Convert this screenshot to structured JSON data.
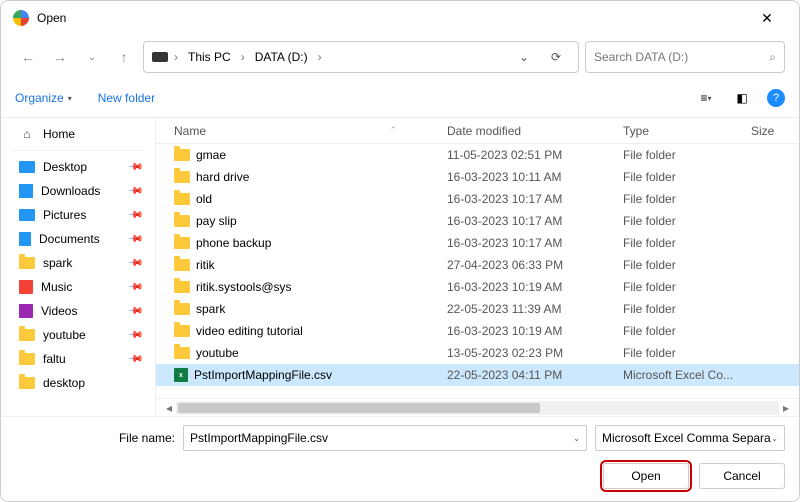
{
  "titlebar": {
    "title": "Open"
  },
  "nav": {
    "breadcrumb": [
      {
        "label": "This PC"
      },
      {
        "label": "DATA (D:)"
      }
    ],
    "search_placeholder": "Search DATA (D:)"
  },
  "toolbar": {
    "organize": "Organize",
    "newfolder": "New folder"
  },
  "sidebar": {
    "home": "Home",
    "items": [
      {
        "label": "Desktop",
        "icon": "desktop",
        "pin": true
      },
      {
        "label": "Downloads",
        "icon": "downloads",
        "pin": true
      },
      {
        "label": "Pictures",
        "icon": "pictures",
        "pin": true
      },
      {
        "label": "Documents",
        "icon": "docs",
        "pin": true
      },
      {
        "label": "spark",
        "icon": "folder",
        "pin": true
      },
      {
        "label": "Music",
        "icon": "music",
        "pin": true
      },
      {
        "label": "Videos",
        "icon": "videos",
        "pin": true
      },
      {
        "label": "youtube",
        "icon": "folder",
        "pin": true
      },
      {
        "label": "faltu",
        "icon": "folder",
        "pin": true
      },
      {
        "label": "desktop",
        "icon": "folder",
        "pin": false
      }
    ]
  },
  "columns": {
    "name": "Name",
    "date": "Date modified",
    "type": "Type",
    "size": "Size"
  },
  "files": [
    {
      "name": "gmae",
      "date": "11-05-2023 02:51 PM",
      "type": "File folder",
      "kind": "folder",
      "sel": false
    },
    {
      "name": "hard drive",
      "date": "16-03-2023 10:11 AM",
      "type": "File folder",
      "kind": "folder",
      "sel": false
    },
    {
      "name": "old",
      "date": "16-03-2023 10:17 AM",
      "type": "File folder",
      "kind": "folder",
      "sel": false
    },
    {
      "name": "pay slip",
      "date": "16-03-2023 10:17 AM",
      "type": "File folder",
      "kind": "folder",
      "sel": false
    },
    {
      "name": "phone backup",
      "date": "16-03-2023 10:17 AM",
      "type": "File folder",
      "kind": "folder",
      "sel": false
    },
    {
      "name": "ritik",
      "date": "27-04-2023 06:33 PM",
      "type": "File folder",
      "kind": "folder",
      "sel": false
    },
    {
      "name": "ritik.systools@sys",
      "date": "16-03-2023 10:19 AM",
      "type": "File folder",
      "kind": "folder",
      "sel": false
    },
    {
      "name": "spark",
      "date": "22-05-2023 11:39 AM",
      "type": "File folder",
      "kind": "folder",
      "sel": false
    },
    {
      "name": "video editing tutorial",
      "date": "16-03-2023 10:19 AM",
      "type": "File folder",
      "kind": "folder",
      "sel": false
    },
    {
      "name": "youtube",
      "date": "13-05-2023 02:23 PM",
      "type": "File folder",
      "kind": "folder",
      "sel": false
    },
    {
      "name": "PstImportMappingFile.csv",
      "date": "22-05-2023 04:11 PM",
      "type": "Microsoft Excel Co...",
      "kind": "csv",
      "sel": true
    }
  ],
  "footer": {
    "filename_label": "File name:",
    "filename_value": "PstImportMappingFile.csv",
    "filter": "Microsoft Excel Comma Separa",
    "open": "Open",
    "cancel": "Cancel"
  }
}
